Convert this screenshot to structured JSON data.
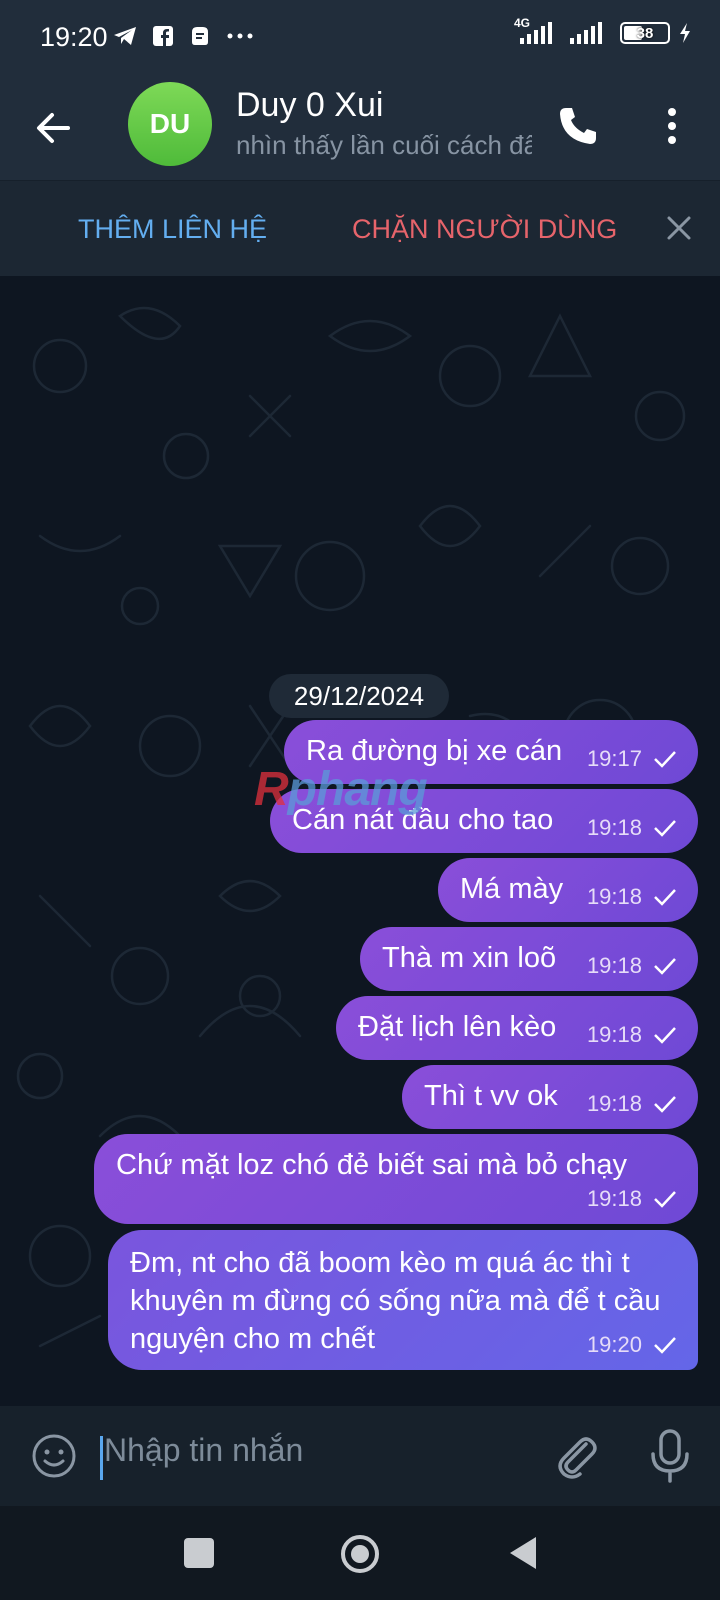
{
  "status_bar": {
    "time": "19:20",
    "network": "4G",
    "battery": "38"
  },
  "header": {
    "avatar_initials": "DU",
    "name": "Duy 0 Xui",
    "status": "nhìn thấy lần cuối cách đây"
  },
  "action_bar": {
    "add_contact": "THÊM LIÊN HỆ",
    "block_user": "CHẶN NGƯỜI DÙNG"
  },
  "chat": {
    "date": "29/12/2024",
    "watermark": "phang",
    "messages": [
      {
        "text": "Ra đường bị xe cán",
        "time": "19:17"
      },
      {
        "text": "Cán nát đầu cho tao",
        "time": "19:18"
      },
      {
        "text": "Má mày",
        "time": "19:18"
      },
      {
        "text": "Thà m xin loõ",
        "time": "19:18"
      },
      {
        "text": "Đặt lịch lên kèo",
        "time": "19:18"
      },
      {
        "text": "Thì t vv ok",
        "time": "19:18"
      },
      {
        "text": "Chứ mặt loz chó đẻ biết sai mà bỏ chạy",
        "time": "19:18"
      },
      {
        "text": "Đm, nt cho đã boom kèo m quá ác thì t khuyên m đừng có sống nữa mà để t cầu nguyện cho m chết",
        "time": "19:20"
      }
    ]
  },
  "input": {
    "placeholder": "Nhập tin nhắn"
  },
  "colors": {
    "bubble": "#7e4bd8",
    "accent": "#63aef0",
    "danger": "#e6646b",
    "avatar": "#5cc440"
  }
}
